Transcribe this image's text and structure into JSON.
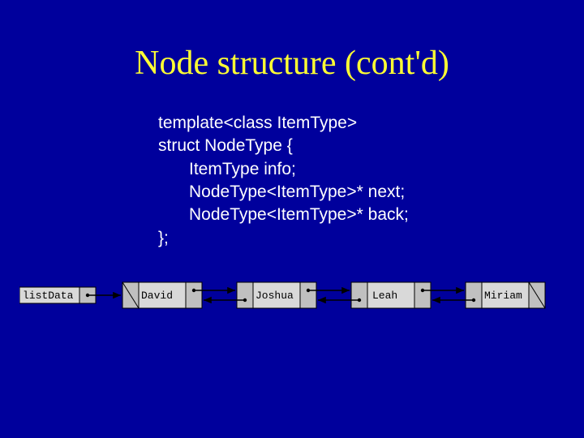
{
  "slide": {
    "title": "Node structure (cont'd)",
    "code": {
      "l1": "template<class ItemType>",
      "l2": "struct NodeType {",
      "l3": "ItemType info;",
      "l4": "NodeType<ItemType>* next;",
      "l5": "NodeType<ItemType>* back;",
      "l6": "};"
    },
    "diagram": {
      "head_label": "listData",
      "nodes": [
        "David",
        "Joshua",
        "Leah",
        "Miriam"
      ]
    }
  }
}
